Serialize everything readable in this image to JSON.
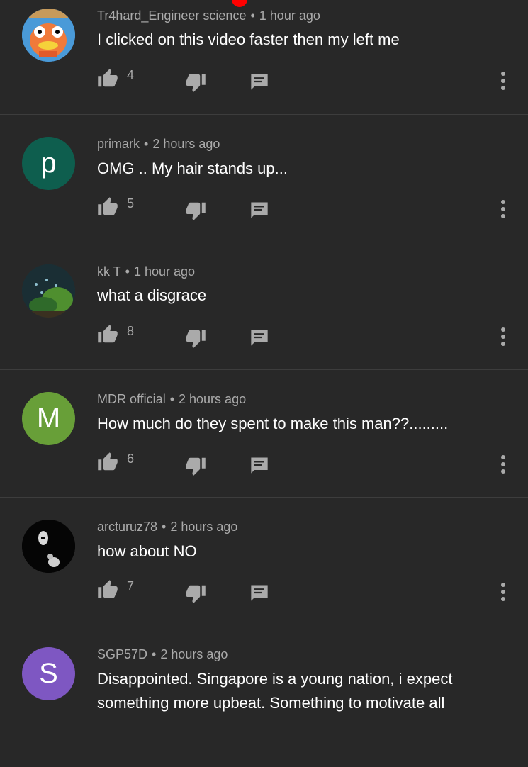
{
  "comments": [
    {
      "author": "Tr4hard_Engineer science",
      "time": "1 hour ago",
      "text": "I clicked on this video faster then my left me",
      "likes": "4",
      "avatar": {
        "type": "image",
        "icon": "fish-character-avatar",
        "bg": "#3a86c8"
      }
    },
    {
      "author": "primark",
      "time": "2 hours ago",
      "text": "OMG .. My hair stands up...",
      "likes": "5",
      "avatar": {
        "type": "letter",
        "letter": "p",
        "bg": "#0e5e4e"
      }
    },
    {
      "author": "kk T",
      "time": "1 hour ago",
      "text": "what a disgrace",
      "likes": "8",
      "avatar": {
        "type": "image",
        "icon": "aquarium-avatar",
        "bg": "#1c3a3e"
      }
    },
    {
      "author": "MDR official",
      "time": "2 hours ago",
      "text": "How much do they spent to make this man??.........",
      "likes": "6",
      "avatar": {
        "type": "letter",
        "letter": "M",
        "bg": "#689f38"
      }
    },
    {
      "author": "arcturuz78",
      "time": "2 hours ago",
      "text": "how about NO",
      "likes": "7",
      "avatar": {
        "type": "image",
        "icon": "dark-figure-avatar",
        "bg": "#050505"
      }
    },
    {
      "author": "SGP57D",
      "time": "2 hours ago",
      "text": "Disappointed. Singapore is a young nation, i expect something more upbeat. Something to motivate all",
      "likes": "",
      "avatar": {
        "type": "letter",
        "letter": "S",
        "bg": "#7e57c2"
      }
    }
  ],
  "icons": {
    "like": "thumbs-up-icon",
    "dislike": "thumbs-down-icon",
    "reply": "reply-comment-icon",
    "more": "more-vert-icon"
  },
  "colors": {
    "background": "#282828",
    "meta_text": "#aaaaaa",
    "divider": "#3d3d3d",
    "accent": "#ff0000"
  }
}
